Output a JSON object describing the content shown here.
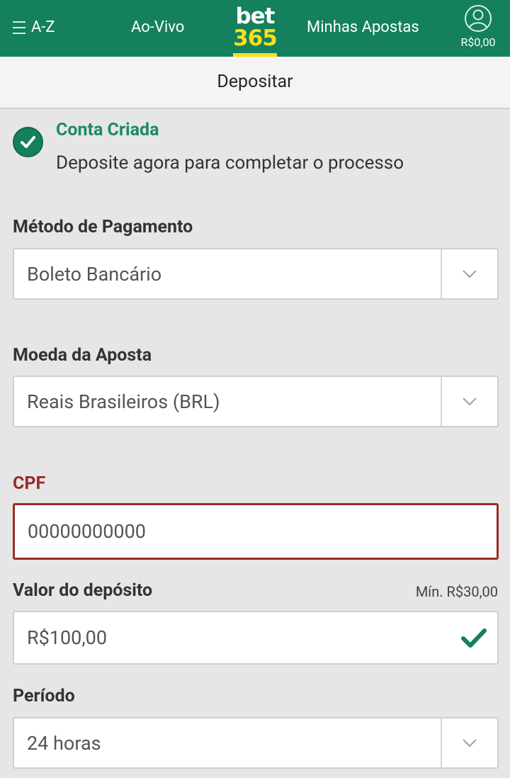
{
  "header": {
    "az_label": "A-Z",
    "live_label": "Ao-Vivo",
    "logo_top": "bet",
    "logo_bottom": "365",
    "my_bets_label": "Minhas Apostas",
    "balance": "R$0,00"
  },
  "page_title": "Depositar",
  "success": {
    "title": "Conta Criada",
    "message": "Deposite agora para completar o processo"
  },
  "form": {
    "payment_method": {
      "label": "Método de Pagamento",
      "value": "Boleto Bancário"
    },
    "currency": {
      "label": "Moeda da Aposta",
      "value": "Reais Brasileiros (BRL)"
    },
    "cpf": {
      "label": "CPF",
      "value": "00000000000"
    },
    "amount": {
      "label": "Valor do depósito",
      "min_hint": "Mín. R$30,00",
      "value": "R$100,00"
    },
    "period": {
      "label": "Período",
      "value": "24 horas"
    }
  },
  "colors": {
    "brand_green": "#14805e",
    "brand_yellow": "#ffdf1b",
    "error_red": "#9b2a28"
  }
}
